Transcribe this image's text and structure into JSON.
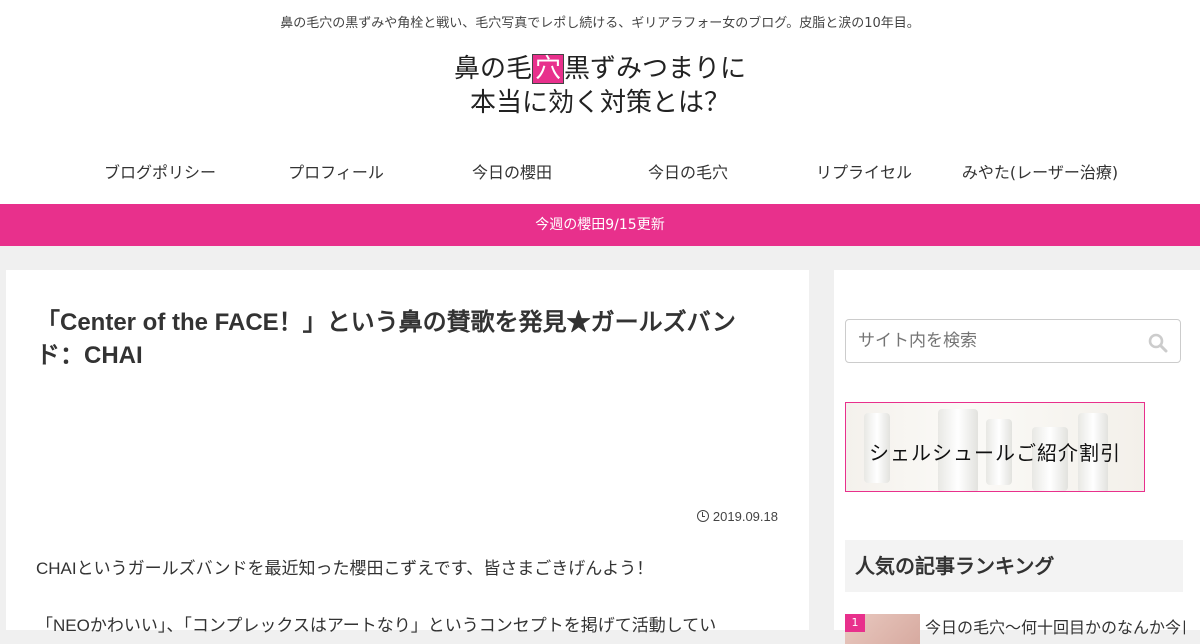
{
  "header": {
    "tagline": "鼻の毛穴の黒ずみや角栓と戦い、毛穴写真でレポし続ける、ギリアラフォー女のブログ。皮脂と涙の10年目。",
    "logo_line1_pre": "鼻の毛",
    "logo_line1_highlight": "穴",
    "logo_line1_post": "黒ずみつまりに",
    "logo_line2": "本当に効く対策とは？"
  },
  "nav": {
    "items": [
      {
        "label": "ブログポリシー"
      },
      {
        "label": "プロフィール"
      },
      {
        "label": "今日の櫻田"
      },
      {
        "label": "今日の毛穴"
      },
      {
        "label": "リプライセル"
      },
      {
        "label": "みやた(レーザー治療)"
      }
    ]
  },
  "notice": {
    "text": "今週の櫻田9/15更新"
  },
  "article": {
    "title": "「Center of the FACE！」という鼻の賛歌を発見★ガールズバンド：CHAI",
    "date": "2019.09.18",
    "paragraph1": "CHAIというガールズバンドを最近知った櫻田こずえです、皆さまごきげんよう！",
    "paragraph2": "「NEOかわいい」、「コンプレックスはアートなり」というコンセプトを掲げて活動してい"
  },
  "sidebar": {
    "search_placeholder": "サイト内を検索",
    "banner_text": "シェルシュールご紹介割引",
    "ranking_heading": "人気の記事ランキング",
    "ranking": [
      {
        "rank": "1",
        "title": "今日の毛穴〜何十回目かのなんか今日"
      }
    ]
  },
  "colors": {
    "accent": "#e8308c"
  },
  "icons": {
    "date": "clock-icon",
    "search": "search-icon"
  }
}
